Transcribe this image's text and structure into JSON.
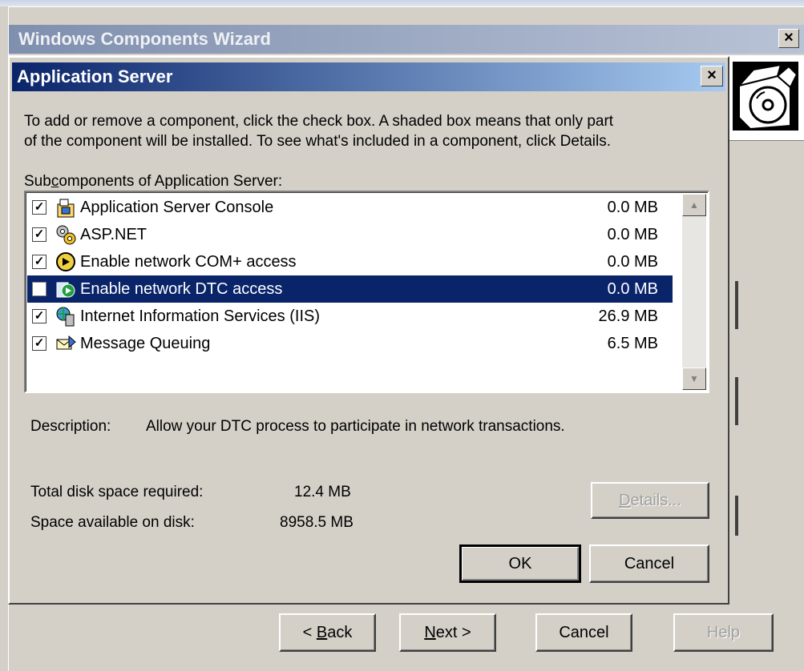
{
  "wizard": {
    "title": "Windows Components Wizard",
    "close_glyph": "×",
    "buttons": {
      "back": "< Back",
      "next": "Next >",
      "cancel": "Cancel",
      "help": "Help"
    }
  },
  "dialog": {
    "title": "Application Server",
    "close_glyph": "×",
    "intro_line1": "To add or remove a component, click the check box. A shaded box means that only part",
    "intro_line2": "of the component will be installed. To see what's included in a component, click Details.",
    "subcomponents_label": "Subcomponents of Application Server:",
    "components": [
      {
        "name": "Application Server Console",
        "size": "0.0 MB",
        "checked": true,
        "selected": false,
        "icon": "console-icon"
      },
      {
        "name": "ASP.NET",
        "size": "0.0 MB",
        "checked": true,
        "selected": false,
        "icon": "gears-icon"
      },
      {
        "name": "Enable network COM+ access",
        "size": "0.0 MB",
        "checked": true,
        "selected": false,
        "icon": "network-globe-icon"
      },
      {
        "name": "Enable network DTC access",
        "size": "0.0 MB",
        "checked": false,
        "selected": true,
        "icon": "dtc-icon"
      },
      {
        "name": "Internet Information Services (IIS)",
        "size": "26.9 MB",
        "checked": true,
        "selected": false,
        "icon": "iis-server-icon"
      },
      {
        "name": "Message Queuing",
        "size": "6.5 MB",
        "checked": true,
        "selected": false,
        "icon": "message-queue-icon"
      }
    ],
    "description_label": "Description:",
    "description_text": "Allow your DTC process to participate in network transactions.",
    "total_label": "Total disk space required:",
    "total_value": "12.4 MB",
    "available_label": "Space available on disk:",
    "available_value": "8958.5 MB",
    "buttons": {
      "details": "Details...",
      "ok": "OK",
      "cancel": "Cancel"
    }
  }
}
